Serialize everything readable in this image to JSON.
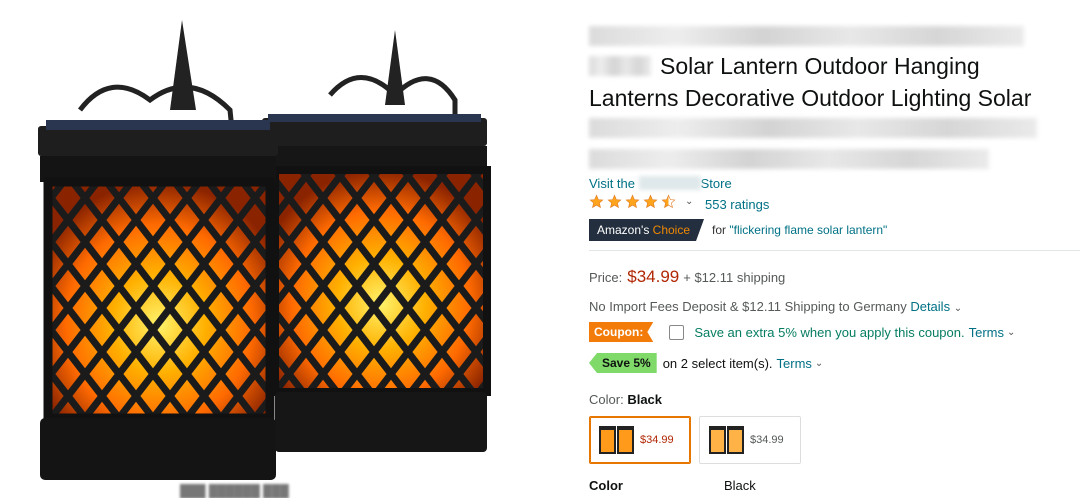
{
  "title": {
    "line2": "Solar Lantern Outdoor Hanging",
    "line3": "Lanterns Decorative Outdoor Lighting Solar"
  },
  "store": {
    "prefix": "Visit the",
    "suffix": "Store"
  },
  "rating": {
    "stars": 4.5,
    "count_label": "553 ratings"
  },
  "badge": {
    "part1": "Amazon's",
    "part2": "Choice",
    "for_label": "for",
    "keyword": "\"flickering flame solar lantern\""
  },
  "price": {
    "label": "Price:",
    "value": "$34.99",
    "shipping": "+ $12.11 shipping"
  },
  "import": {
    "text": "No Import Fees Deposit & $12.11 Shipping to Germany",
    "details_link": "Details"
  },
  "coupon": {
    "tag": "Coupon:",
    "text": "Save an extra 5% when you apply this coupon.",
    "terms": "Terms"
  },
  "save": {
    "tag": "Save 5%",
    "text": "on 2 select item(s).",
    "terms": "Terms"
  },
  "color": {
    "label": "Color:",
    "selected": "Black",
    "options": [
      {
        "price": "$34.99",
        "selected": true
      },
      {
        "price": "$34.99",
        "selected": false
      }
    ]
  },
  "details_table": {
    "key": "Color",
    "value": "Black"
  },
  "colors": {
    "link": "#007185",
    "price": "#B12704",
    "coupon": "#F27B0A",
    "save": "#7FDA69",
    "badge": "#232F3E",
    "star": "#FFA41C"
  }
}
